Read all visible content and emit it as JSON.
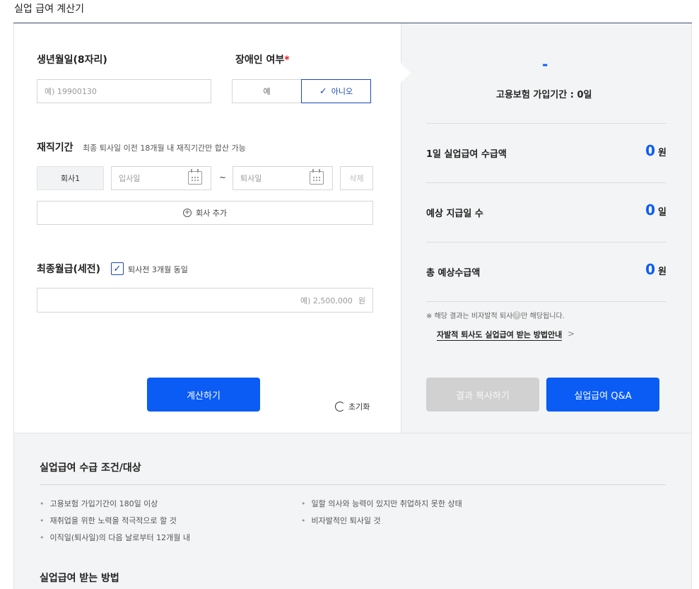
{
  "page": {
    "title": "실업 급여 계산기"
  },
  "form": {
    "birth": {
      "label": "생년월일(8자리)",
      "placeholder": "예) 19900130"
    },
    "disability": {
      "label": "장애인 여부",
      "required_mark": "*",
      "options": [
        "예",
        "아니오"
      ],
      "selected": "아니오"
    },
    "employment": {
      "label": "재직기간",
      "hint": "최종 퇴사일 이전 18개월 내 재직기간만 합산 가능",
      "company_label": "회사1",
      "start_placeholder": "입사일",
      "separator": "~",
      "end_placeholder": "퇴사일",
      "delete_label": "삭제",
      "add_label": "회사 추가"
    },
    "salary": {
      "label": "최종월급(세전)",
      "checkbox_label": "퇴사전 3개월 동일",
      "checkbox_checked": true,
      "placeholder": "예) 2,500,000",
      "unit": "원"
    },
    "calculate_label": "계산하기",
    "reset_label": "초기화"
  },
  "result": {
    "headline": "-",
    "insured_period": "고용보험 가입기간 : 0일",
    "rows": [
      {
        "label": "1일 실업급여 수급액",
        "value": "0",
        "unit": "원"
      },
      {
        "label": "예상 지급일 수",
        "value": "0",
        "unit": "일"
      },
      {
        "label": "총 예상수급액",
        "value": "0",
        "unit": "원"
      }
    ],
    "note_prefix": "※ 해당 결과는 비자발적 퇴사",
    "note_suffix": "만 해당됩니다.",
    "note_icon": "?",
    "guide_link": "자발적 퇴사도 실업급여 받는 방법안내",
    "copy_label": "결과 복사하기",
    "qa_label": "실업급여 Q&A"
  },
  "info": {
    "conditions_title": "실업급여 수급 조건/대상",
    "conditions": [
      "고용보험 가입기간이 180일 이상",
      "재취업을 위한 노력을 적극적으로 할 것",
      "이직일(퇴사일)의 다음 날로부터 12개월 내",
      "일할 의사와 능력이 있지만 취업하지 못한 상태",
      "비자발적인 퇴사일 것"
    ],
    "how_title": "실업급여 받는 방법"
  },
  "colors": {
    "accent": "#0a5cf5",
    "selected_border": "#1a47b8",
    "required": "#e8192c",
    "panel_bg": "#f3f4f5"
  }
}
